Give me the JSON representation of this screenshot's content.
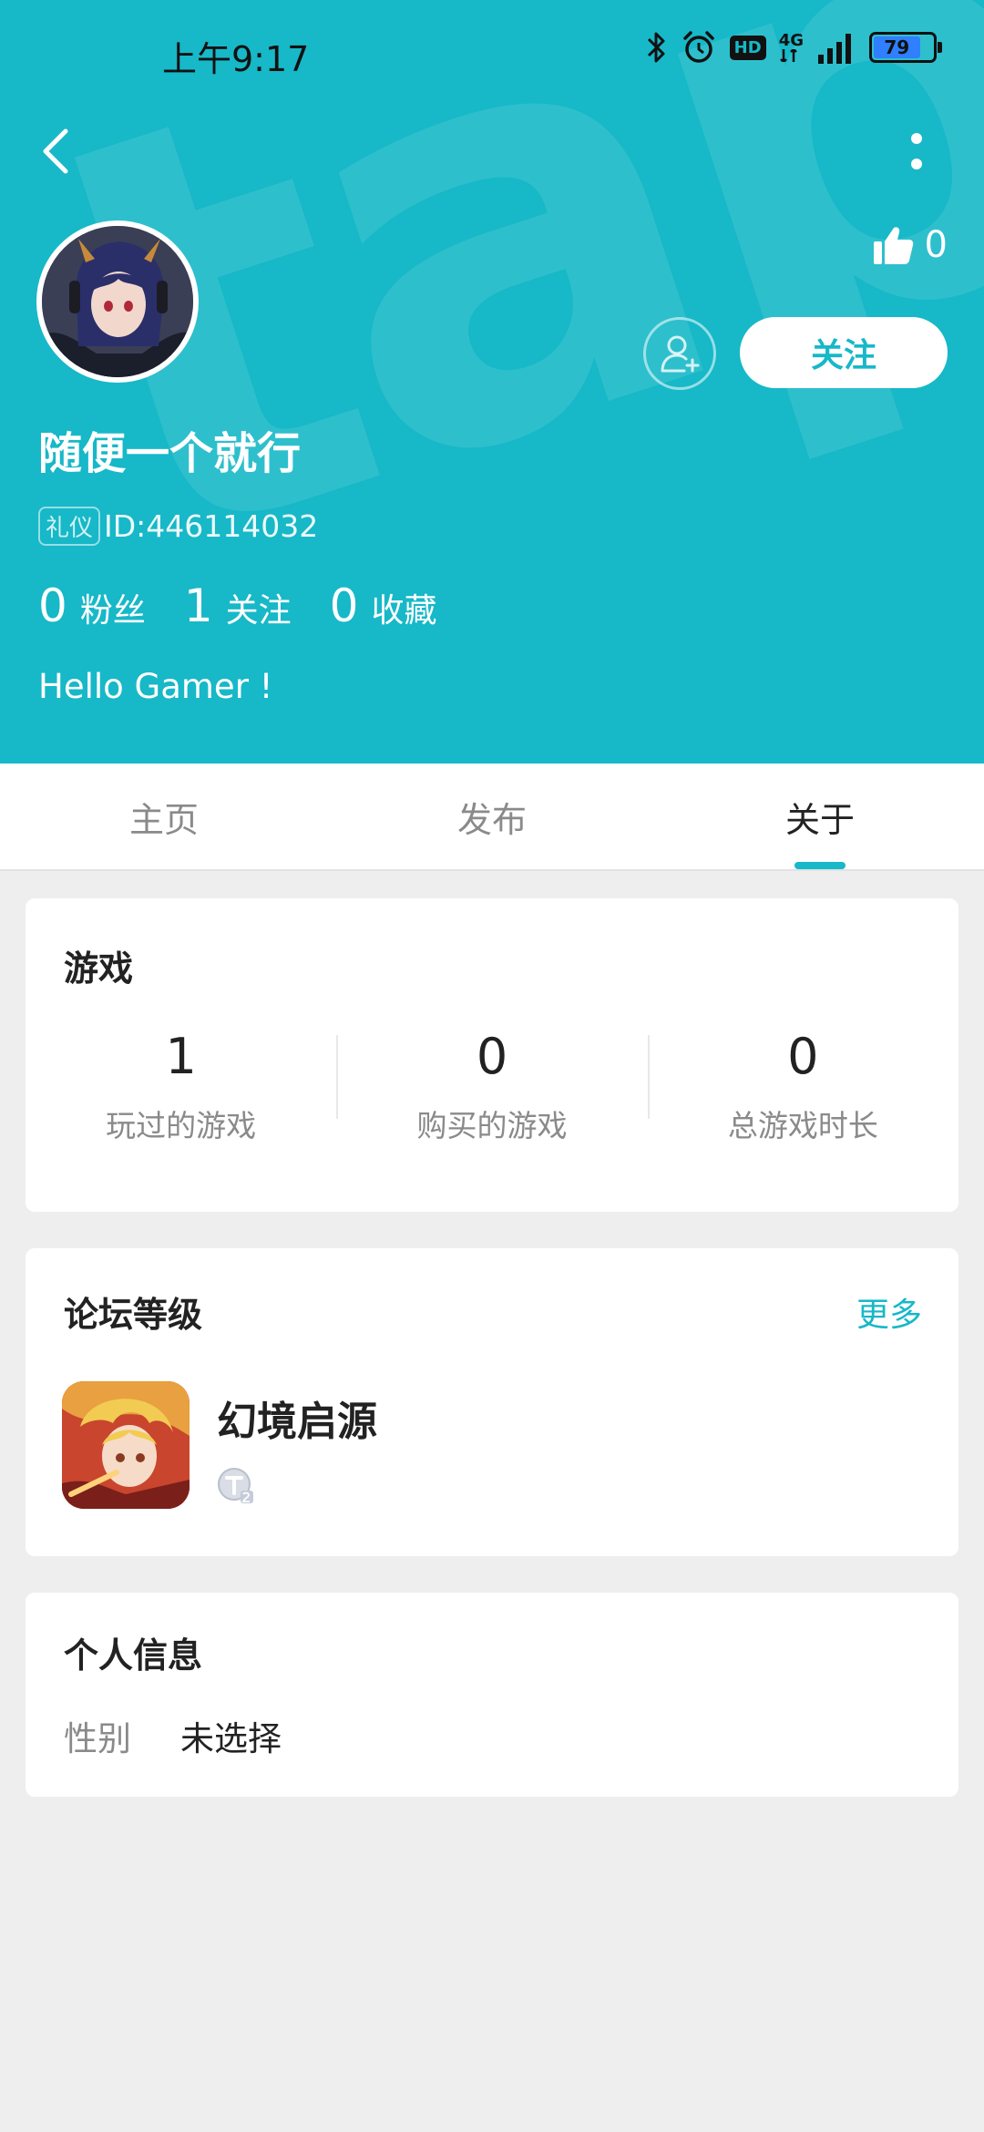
{
  "status_bar": {
    "time": "上午9:17",
    "hd": "HD",
    "network": "4G",
    "battery": "79"
  },
  "header": {
    "likes_count": "0",
    "follow_label": "关注",
    "username": "随便一个就行",
    "id_tag": "礼仪",
    "user_id": "ID:446114032",
    "stats": [
      {
        "num": "0",
        "label": "粉丝"
      },
      {
        "num": "1",
        "label": "关注"
      },
      {
        "num": "0",
        "label": "收藏"
      }
    ],
    "bio": "Hello Gamer !",
    "watermark": "tap",
    "accent": "#17b8c8"
  },
  "tabs": [
    {
      "label": "主页"
    },
    {
      "label": "发布"
    },
    {
      "label": "关于"
    }
  ],
  "games": {
    "title": "游戏",
    "stats": [
      {
        "num": "1",
        "label": "玩过的游戏"
      },
      {
        "num": "0",
        "label": "购买的游戏"
      },
      {
        "num": "0",
        "label": "总游戏时长"
      }
    ]
  },
  "forum": {
    "title": "论坛等级",
    "more": "更多",
    "game_name": "幻境启源"
  },
  "info": {
    "title": "个人信息",
    "gender_label": "性别",
    "gender_value": "未选择"
  }
}
